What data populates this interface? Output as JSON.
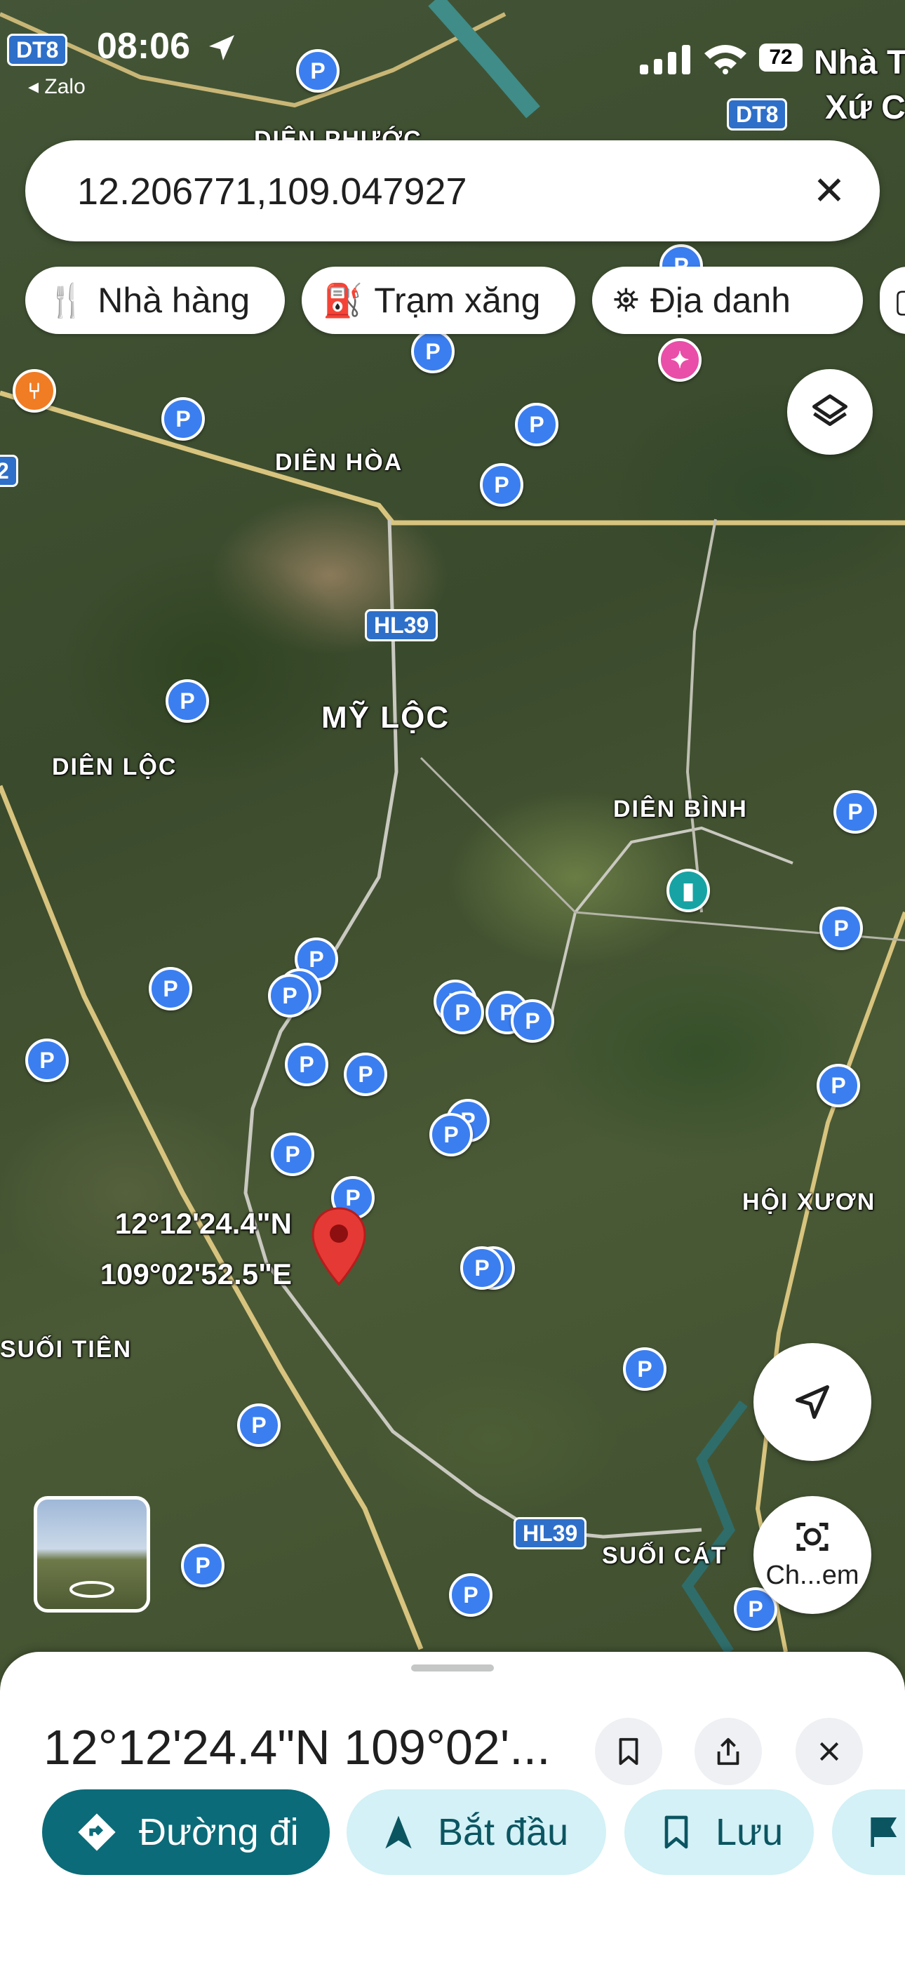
{
  "status_bar": {
    "time": "08:06",
    "back_app": "◂ Zalo",
    "battery": "72"
  },
  "search": {
    "value": "12.206771,109.047927"
  },
  "chips": [
    {
      "label": "Nhà hàng",
      "icon": "fork-knife-icon"
    },
    {
      "label": "Trạm xăng",
      "icon": "gas-station-icon"
    },
    {
      "label": "Địa danh",
      "icon": "landmark-icon"
    }
  ],
  "map": {
    "places": [
      {
        "label": "DIÊN PHƯỚC"
      },
      {
        "label": "DIÊN HÒA"
      },
      {
        "label": "MỸ LỘC"
      },
      {
        "label": "DIÊN LỘC"
      },
      {
        "label": "DIÊN BÌNH"
      },
      {
        "label": "HỘI XƯƠN"
      },
      {
        "label": "SUỐI TIÊN"
      },
      {
        "label": "SUỐI CÁT"
      },
      {
        "label": "Nhà T"
      },
      {
        "label": "Xứ C"
      }
    ],
    "road_shields": [
      "DT8",
      "DT8",
      "HL39",
      "HL39",
      "2"
    ],
    "pin_label_lat": "12°12'24.4\"N",
    "pin_label_lon": "109°02'52.5\"E"
  },
  "lens": {
    "label": "Ch...em"
  },
  "sheet": {
    "title": "12°12'24.4\"N 109°02'...",
    "actions": [
      {
        "label": "Đường đi"
      },
      {
        "label": "Bắt đầu"
      },
      {
        "label": "Lưu"
      }
    ]
  },
  "colors": {
    "primary": "#0b6b78",
    "secondary": "#d3f1f6",
    "poi_blue": "#3b7ef0",
    "pin_red": "#e53935"
  }
}
